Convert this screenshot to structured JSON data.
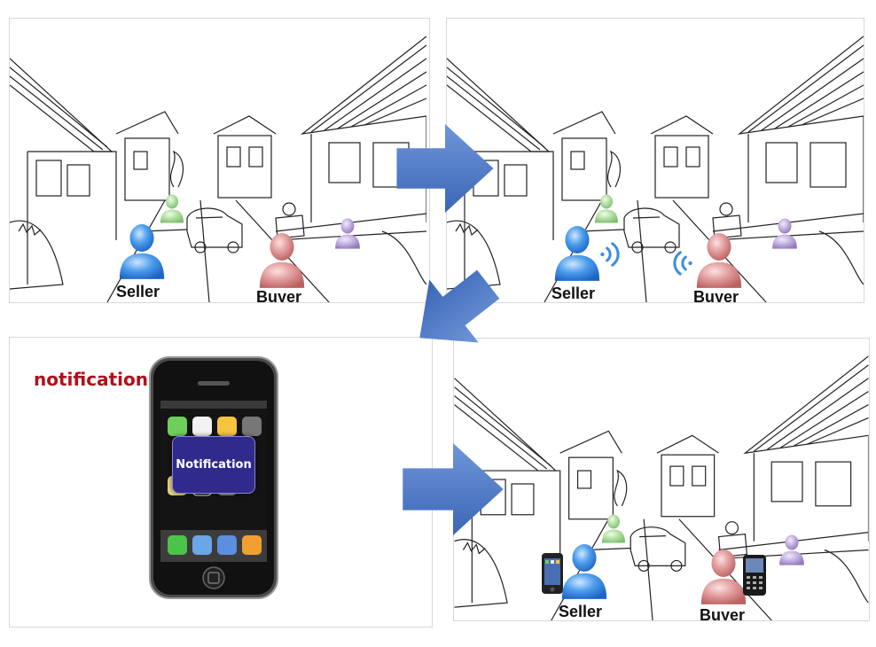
{
  "panels": [
    {
      "seller_label": "Seller",
      "buyer_label": "Buyer"
    },
    {
      "seller_label": "Seller",
      "buyer_label": "Buyer"
    },
    {
      "title": "notification",
      "notification_label": "Notification"
    },
    {
      "seller_label": "Seller",
      "buyer_label": "Buyer"
    }
  ],
  "colors": {
    "arrow": "#4a76c2",
    "seller": "#3b8de0",
    "buyer": "#d98a8a",
    "bystander_green": "#a8d89a",
    "bystander_purple": "#b9a3d9",
    "notification_title": "#b0101b",
    "notification_box": "#2f2a8c",
    "wifi_signal": "#3b8de0"
  },
  "icons": [
    "person-icon",
    "wifi-signal-icon",
    "smartphone-icon",
    "arrow-right-icon",
    "house-sketch"
  ]
}
